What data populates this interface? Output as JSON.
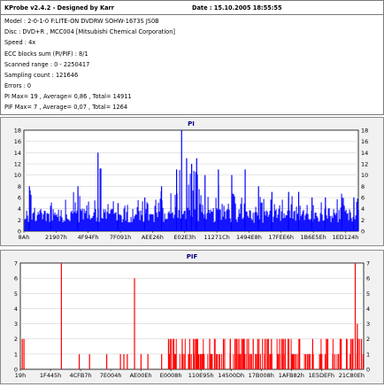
{
  "info": {
    "title": "KProbe v2.4.2 - Designed by Karr",
    "date": "Date : 15.10.2005 18:55:55",
    "lines": [
      "Model : 2-0-1-0 F:LITE-ON DVDRW SOHW-1673S JS0B",
      "Disc : DVD+R , MCC004 [Mitsubishi Chemical Corporation]",
      "Speed : 4x",
      "ECC blocks sum (PI/PIF) : 8/1",
      "Scanned range : 0 - 2250417",
      "Sampling count : 121646",
      "Errors : 0",
      "PI Max= 19 , Average= 0,86 , Total= 14911",
      "PIF Max= 7 , Average= 0,07 , Total= 1264"
    ]
  },
  "chart_data": [
    {
      "type": "bar",
      "title": "PI",
      "color": "#0000ff",
      "ylim": [
        0,
        18
      ],
      "yticks": [
        0,
        2,
        4,
        6,
        8,
        10,
        12,
        14,
        16,
        18
      ],
      "xticks": [
        "8Ah",
        "21907h",
        "4F94Fh",
        "7F091h",
        "AEE26h",
        "E02E3h",
        "11271Ch",
        "1494E8h",
        "17FEE6h",
        "1B6E5Eh",
        "1ED124h"
      ],
      "summary": {
        "max": 19,
        "average": 0.86,
        "total": 14911
      },
      "peaks": [
        {
          "position": 0.015,
          "value": 8
        },
        {
          "position": 0.08,
          "value": 4
        },
        {
          "position": 0.16,
          "value": 8
        },
        {
          "position": 0.22,
          "value": 14
        },
        {
          "position": 0.28,
          "value": 5
        },
        {
          "position": 0.36,
          "value": 6
        },
        {
          "position": 0.41,
          "value": 8
        },
        {
          "position": 0.455,
          "value": 11
        },
        {
          "position": 0.47,
          "value": 19
        },
        {
          "position": 0.485,
          "value": 13
        },
        {
          "position": 0.5,
          "value": 12
        },
        {
          "position": 0.515,
          "value": 13
        },
        {
          "position": 0.54,
          "value": 10
        },
        {
          "position": 0.58,
          "value": 11
        },
        {
          "position": 0.62,
          "value": 10
        },
        {
          "position": 0.66,
          "value": 11
        },
        {
          "position": 0.7,
          "value": 8
        },
        {
          "position": 0.74,
          "value": 7
        },
        {
          "position": 0.79,
          "value": 7
        },
        {
          "position": 0.82,
          "value": 7
        },
        {
          "position": 0.86,
          "value": 6
        },
        {
          "position": 0.9,
          "value": 6
        },
        {
          "position": 0.95,
          "value": 6
        },
        {
          "position": 0.985,
          "value": 6
        }
      ]
    },
    {
      "type": "bar",
      "title": "PIF",
      "color": "#ff0000",
      "ylim": [
        0,
        7
      ],
      "yticks": [
        0,
        1,
        2,
        3,
        4,
        5,
        6,
        7
      ],
      "xticks": [
        "19h",
        "1F445h",
        "4CFB7h",
        "7E004h",
        "AE00Eh",
        "E0008h",
        "110E95h",
        "14500Dh",
        "17B008h",
        "1AFB82h",
        "1E5DEFh",
        "21C80Eh"
      ],
      "summary": {
        "max": 7,
        "average": 0.07,
        "total": 1264
      },
      "bars": [
        {
          "position": 0.004,
          "value": 2
        },
        {
          "position": 0.009,
          "value": 2
        },
        {
          "position": 0.118,
          "value": 7
        },
        {
          "position": 0.17,
          "value": 1
        },
        {
          "position": 0.2,
          "value": 1
        },
        {
          "position": 0.25,
          "value": 1
        },
        {
          "position": 0.29,
          "value": 1
        },
        {
          "position": 0.3,
          "value": 1
        },
        {
          "position": 0.31,
          "value": 1
        },
        {
          "position": 0.331,
          "value": 6
        },
        {
          "position": 0.35,
          "value": 1
        },
        {
          "position": 0.37,
          "value": 1
        },
        {
          "position": 0.41,
          "value": 1
        },
        {
          "position": 0.43,
          "value": 2
        },
        {
          "position": 0.45,
          "value": 1
        },
        {
          "position": 0.47,
          "value": 2
        },
        {
          "position": 0.49,
          "value": 1
        },
        {
          "position": 0.51,
          "value": 2
        },
        {
          "position": 0.53,
          "value": 1
        },
        {
          "position": 0.55,
          "value": 2
        },
        {
          "position": 0.57,
          "value": 1
        },
        {
          "position": 0.59,
          "value": 2
        },
        {
          "position": 0.61,
          "value": 2
        },
        {
          "position": 0.63,
          "value": 1
        },
        {
          "position": 0.65,
          "value": 2
        },
        {
          "position": 0.67,
          "value": 1
        },
        {
          "position": 0.69,
          "value": 2
        },
        {
          "position": 0.71,
          "value": 1
        },
        {
          "position": 0.73,
          "value": 2
        },
        {
          "position": 0.75,
          "value": 1
        },
        {
          "position": 0.77,
          "value": 2
        },
        {
          "position": 0.79,
          "value": 1
        },
        {
          "position": 0.81,
          "value": 2
        },
        {
          "position": 0.83,
          "value": 1
        },
        {
          "position": 0.85,
          "value": 2
        },
        {
          "position": 0.87,
          "value": 1
        },
        {
          "position": 0.89,
          "value": 2
        },
        {
          "position": 0.91,
          "value": 1
        },
        {
          "position": 0.93,
          "value": 2
        },
        {
          "position": 0.95,
          "value": 2
        },
        {
          "position": 0.965,
          "value": 2
        },
        {
          "position": 0.974,
          "value": 7
        },
        {
          "position": 0.98,
          "value": 3
        },
        {
          "position": 0.986,
          "value": 2
        },
        {
          "position": 0.992,
          "value": 2
        },
        {
          "position": 0.997,
          "value": 1
        }
      ]
    }
  ]
}
